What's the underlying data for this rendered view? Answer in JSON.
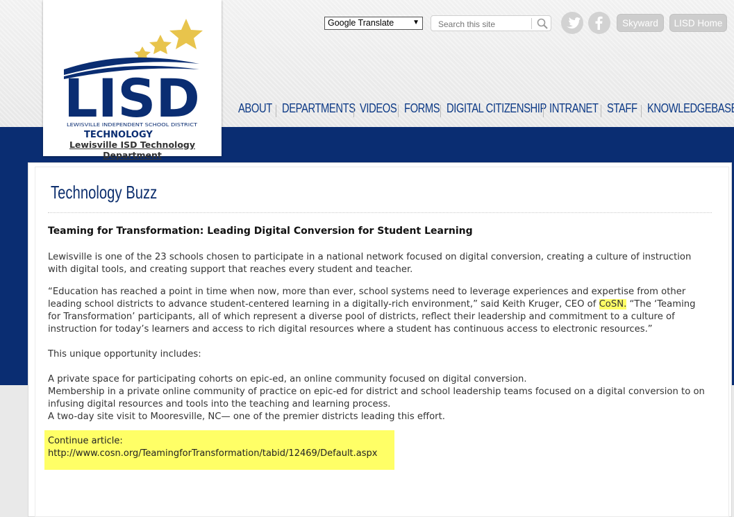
{
  "header": {
    "logo_primary": "LISD",
    "logo_district": "LEWISVILLE INDEPENDENT SCHOOL DISTRICT",
    "logo_department": "TECHNOLOGY",
    "site_name": "Lewisville ISD Technology Department",
    "translate_label": "Google Translate",
    "search_placeholder": "Search this site",
    "skyward_label": "Skyward",
    "lisd_home_label": "LISD Home"
  },
  "nav": {
    "items": [
      "ABOUT",
      "DEPARTMENTS",
      "VIDEOS",
      "FORMS",
      "DIGITAL CITIZENSHIP",
      "INTRANET",
      "STAFF",
      "KNOWLEDGEBASE"
    ]
  },
  "article": {
    "section_title": "Technology Buzz",
    "headline": "Teaming for Transformation: Leading Digital Conversion for Student Learning",
    "p1": "Lewisville is one of the 23 schools chosen to participate in a national network focused on digital conversion, creating a culture of instruction with digital tools, and creating support that reaches every student and teacher.",
    "p2_before": "“Education has reached a point in time when now, more than ever, school systems need to leverage experiences and expertise from other leading school districts to advance student-centered learning in a digitally-rich environment,” said Keith Kruger, CEO of ",
    "p2_highlight": "CoSN.",
    "p2_after": " “The ‘Teaming for Transformation’ participants, all of which represent a diverse pool of districts, reflect their leadership and commitment to a culture of instruction for today’s learners and access to rich digital resources where a student has continuous access to electronic resources.”",
    "p3": "This unique opportunity includes:",
    "list1": "A private space for participating cohorts on epic-ed, an online community focused on digital conversion.",
    "list2": "Membership in a private online community of practice on epic-ed for district and school leadership teams focused on a digital conversion to on infusing digital resources and tools into the teaching and learning process.",
    "list3": "A two-day site visit to Mooresville, NC— one of the premier districts leading this effort.",
    "continue_label": "Continue article:",
    "continue_url": "http://www.cosn.org/TeamingforTransformation/tabid/12469/Default.aspx"
  },
  "colors": {
    "brand_navy": "#0a2d72",
    "nav_blue": "#0d3a86",
    "highlight": "#ffff66",
    "star_gold": "#e8c44c"
  },
  "icons": [
    "dropdown-arrow-icon",
    "search-icon",
    "twitter-icon",
    "facebook-icon",
    "star-icon"
  ]
}
